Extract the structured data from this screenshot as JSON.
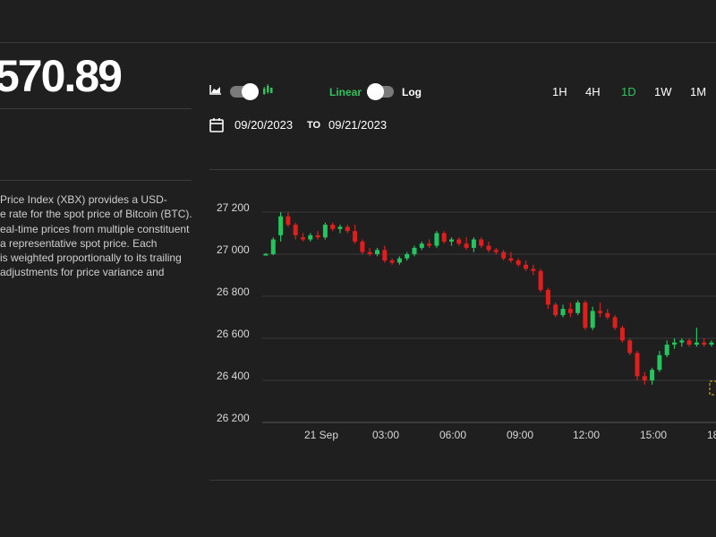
{
  "price": {
    "value": "570.89"
  },
  "description": {
    "lines": [
      "Price Index (XBX) provides a USD-",
      "e rate for the spot price of Bitcoin (BTC).",
      "eal-time prices from multiple constituent",
      "a representative spot price. Each",
      "is weighted proportionally to its trailing",
      "adjustments for price variance and"
    ]
  },
  "controls": {
    "chart_type_icons": [
      "area-chart-icon",
      "candlestick-chart-icon"
    ],
    "chart_type_selected": "candlestick",
    "scale_linear_label": "Linear",
    "scale_log_label": "Log",
    "scale_selected": "Linear",
    "timeframes": [
      "1H",
      "4H",
      "1D",
      "1W",
      "1M"
    ],
    "timeframe_selected": "1D",
    "accent_color": "#35c15f"
  },
  "date_range": {
    "from": "09/20/2023",
    "separator": "TO",
    "to": "09/21/2023"
  },
  "chart_data": {
    "type": "candlestick",
    "ylim": [
      26200,
      27300
    ],
    "y_ticks": [
      27200,
      27000,
      26800,
      26600,
      26400,
      26200
    ],
    "y_tick_labels": [
      "27 200",
      "27 000",
      "26 800",
      "26 600",
      "26 400",
      "26 200"
    ],
    "x_tick_labels": [
      "21 Sep",
      "03:00",
      "06:00",
      "09:00",
      "12:00",
      "15:00",
      "18"
    ],
    "up_color": "#22c55e",
    "down_color": "#e01e1e",
    "candles": [
      [
        27000,
        27005,
        26998,
        27002
      ],
      [
        27000,
        27080,
        26995,
        27070
      ],
      [
        27090,
        27200,
        27060,
        27180
      ],
      [
        27180,
        27200,
        27130,
        27140
      ],
      [
        27140,
        27150,
        27070,
        27090
      ],
      [
        27080,
        27100,
        27060,
        27070
      ],
      [
        27070,
        27100,
        27060,
        27090
      ],
      [
        27090,
        27110,
        27070,
        27080
      ],
      [
        27080,
        27150,
        27070,
        27140
      ],
      [
        27140,
        27150,
        27110,
        27120
      ],
      [
        27120,
        27140,
        27100,
        27130
      ],
      [
        27130,
        27140,
        27100,
        27110
      ],
      [
        27110,
        27140,
        27050,
        27060
      ],
      [
        27060,
        27070,
        27000,
        27010
      ],
      [
        27010,
        27030,
        26990,
        27000
      ],
      [
        27000,
        27030,
        26990,
        27020
      ],
      [
        27020,
        27040,
        26960,
        26970
      ],
      [
        26970,
        26980,
        26950,
        26960
      ],
      [
        26960,
        26990,
        26950,
        26980
      ],
      [
        26980,
        27010,
        26970,
        27000
      ],
      [
        27000,
        27040,
        26990,
        27030
      ],
      [
        27030,
        27060,
        27020,
        27050
      ],
      [
        27050,
        27070,
        27030,
        27040
      ],
      [
        27040,
        27110,
        27030,
        27100
      ],
      [
        27100,
        27110,
        27050,
        27060
      ],
      [
        27060,
        27080,
        27040,
        27070
      ],
      [
        27070,
        27080,
        27040,
        27050
      ],
      [
        27050,
        27080,
        27020,
        27030
      ],
      [
        27030,
        27080,
        27010,
        27070
      ],
      [
        27070,
        27080,
        27030,
        27040
      ],
      [
        27040,
        27060,
        27010,
        27020
      ],
      [
        27020,
        27030,
        27000,
        27010
      ],
      [
        27010,
        27020,
        26970,
        26980
      ],
      [
        26980,
        27010,
        26960,
        26970
      ],
      [
        26970,
        26980,
        26940,
        26950
      ],
      [
        26950,
        26970,
        26920,
        26930
      ],
      [
        26930,
        26950,
        26900,
        26920
      ],
      [
        26920,
        26930,
        26820,
        26830
      ],
      [
        26830,
        26840,
        26740,
        26760
      ],
      [
        26760,
        26770,
        26700,
        26710
      ],
      [
        26710,
        26760,
        26700,
        26740
      ],
      [
        26740,
        26770,
        26700,
        26720
      ],
      [
        26720,
        26780,
        26710,
        26770
      ],
      [
        26770,
        26780,
        26640,
        26650
      ],
      [
        26650,
        26750,
        26640,
        26730
      ],
      [
        26730,
        26770,
        26700,
        26720
      ],
      [
        26720,
        26740,
        26690,
        26700
      ],
      [
        26700,
        26710,
        26640,
        26650
      ],
      [
        26650,
        26660,
        26580,
        26590
      ],
      [
        26590,
        26600,
        26520,
        26530
      ],
      [
        26530,
        26540,
        26400,
        26420
      ],
      [
        26420,
        26440,
        26380,
        26400
      ],
      [
        26400,
        26460,
        26380,
        26450
      ],
      [
        26450,
        26540,
        26440,
        26520
      ],
      [
        26520,
        26590,
        26510,
        26570
      ],
      [
        26570,
        26600,
        26550,
        26580
      ],
      [
        26580,
        26600,
        26560,
        26590
      ],
      [
        26590,
        26600,
        26560,
        26570
      ],
      [
        26570,
        26650,
        26560,
        26580
      ],
      [
        26580,
        26600,
        26560,
        26570
      ],
      [
        26570,
        26590,
        26560,
        26580
      ],
      [
        26580,
        26600,
        26560,
        26590
      ]
    ],
    "marker_color": "#a5862d"
  }
}
